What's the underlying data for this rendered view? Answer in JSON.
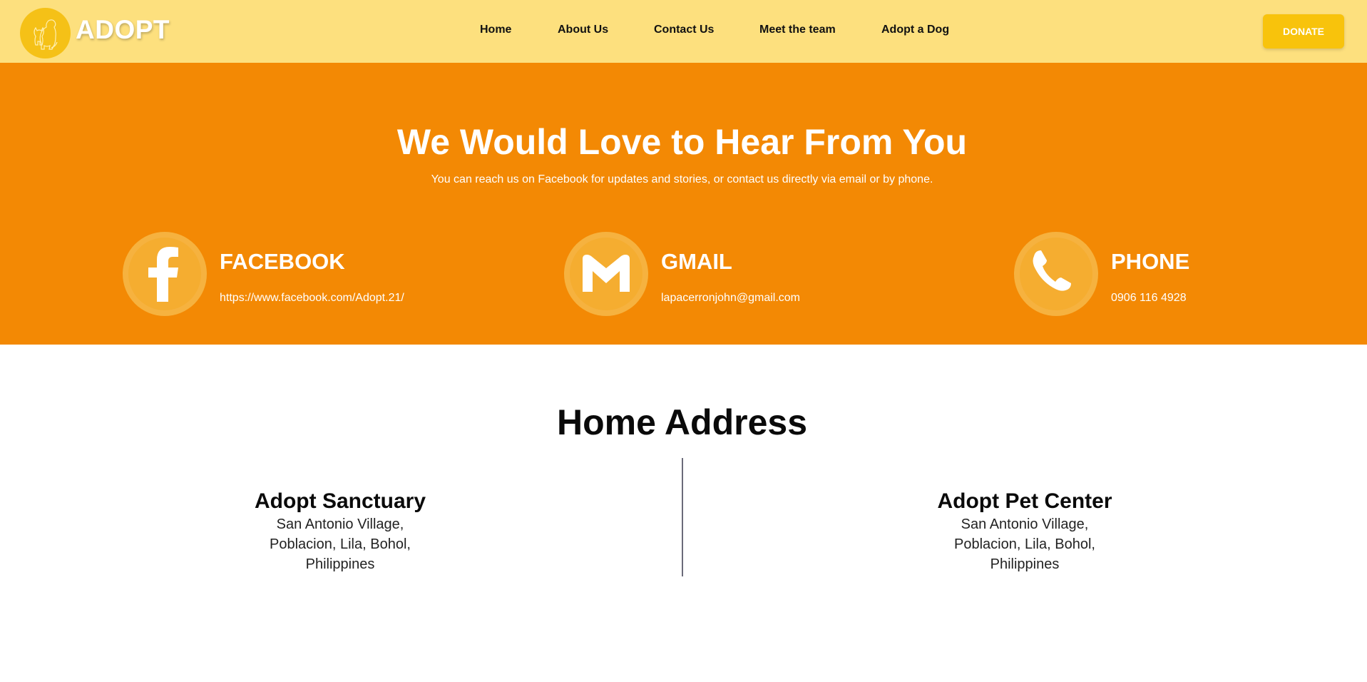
{
  "header": {
    "logo_text": "ADOPT",
    "logo_icon": "dog-cat-outline-icon",
    "nav": [
      "Home",
      "About Us",
      "Contact Us",
      "Meet the team",
      "Adopt a Dog"
    ],
    "donate_label": "DONATE"
  },
  "hero": {
    "title": "We Would Love to Hear From You",
    "subtitle": "You can reach us on Facebook for updates and stories, or contact us directly via email or by phone.",
    "contacts": [
      {
        "icon": "facebook-icon",
        "title": "FACEBOOK",
        "value": "https://www.facebook.com/Adopt.21/"
      },
      {
        "icon": "gmail-icon",
        "title": "GMAIL",
        "value": "lapacerronjohn@gmail.com"
      },
      {
        "icon": "phone-icon",
        "title": "PHONE",
        "value": "0906 116 4928"
      }
    ]
  },
  "address": {
    "title": "Home Address",
    "locations": [
      {
        "name": "Adopt Sanctuary",
        "lines": [
          "San Antonio Village,",
          "Poblacion, Lila, Bohol,",
          "Philippines"
        ]
      },
      {
        "name": "Adopt Pet Center",
        "lines": [
          "San Antonio Village,",
          "Poblacion, Lila, Bohol,",
          "Philippines"
        ]
      }
    ]
  },
  "colors": {
    "header_bg": "#fde07e",
    "hero_bg": "#f38904",
    "accent": "#f8c30c",
    "logo_circle": "#f5c117"
  }
}
